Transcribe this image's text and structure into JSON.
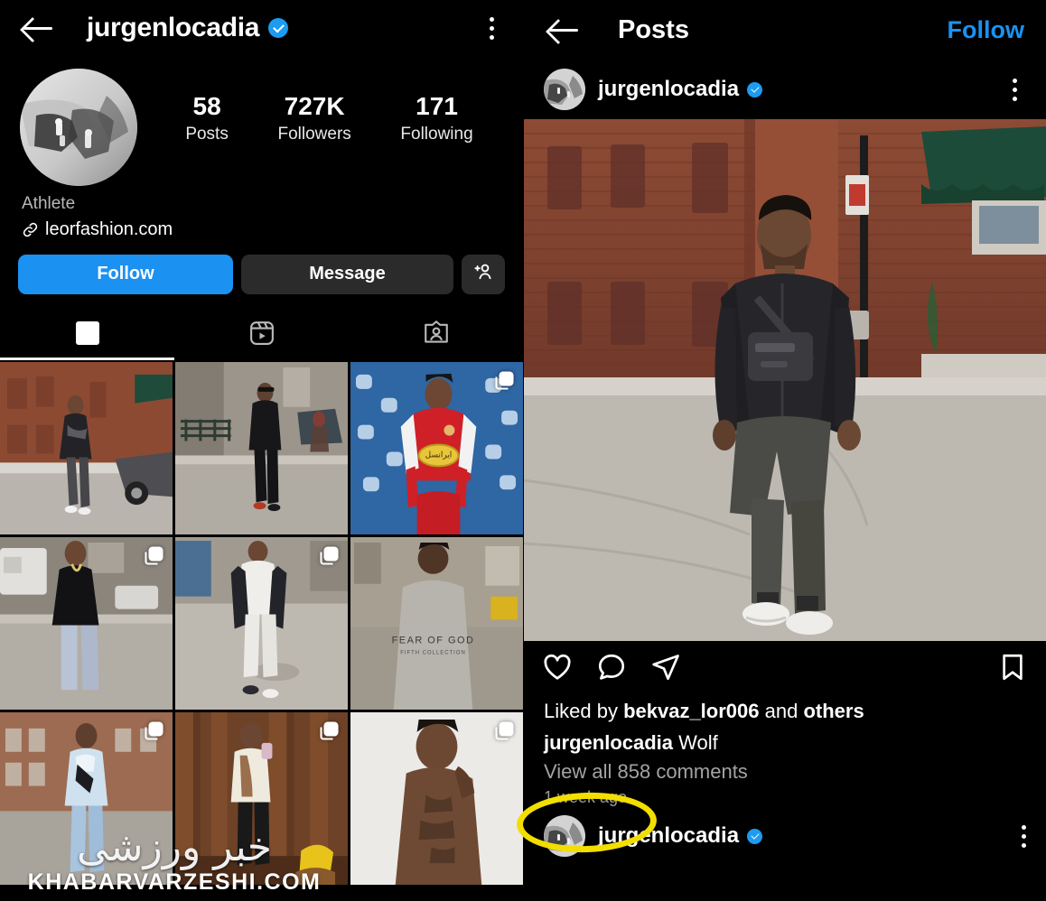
{
  "app": "instagram",
  "colors": {
    "background": "#000000",
    "accent_blue": "#1b91f2",
    "verified_blue": "#1d9bf0",
    "button_grey": "#2b2b2b",
    "muted_text": "#a3a3a3",
    "highlight_yellow": "#F2DE00"
  },
  "profile_pane": {
    "back_icon": "back-arrow-icon",
    "title": "jurgenlocadia",
    "verified": true,
    "menu_icon": "kebab-menu-icon",
    "avatar_alt": "profile-picture",
    "stats": [
      {
        "value": "58",
        "label": "Posts"
      },
      {
        "value": "727K",
        "label": "Followers"
      },
      {
        "value": "171",
        "label": "Following"
      }
    ],
    "category": "Athlete",
    "website_icon": "link-icon",
    "website": "leorfashion.com",
    "buttons": {
      "follow": "Follow",
      "message": "Message",
      "add_user_icon": "add-user-icon"
    },
    "tabs": [
      {
        "icon": "grid-icon",
        "name": "grid",
        "active": true
      },
      {
        "icon": "reels-icon",
        "name": "reels",
        "active": false
      },
      {
        "icon": "tagged-icon",
        "name": "tagged",
        "active": false
      }
    ],
    "grid_posts": [
      {
        "id": 1,
        "alt": "man-walking-street-brick-building",
        "carousel": false
      },
      {
        "id": 2,
        "alt": "man-standing-sidewalk-black-outfit",
        "carousel": false
      },
      {
        "id": 3,
        "alt": "footballer-red-persepolis-jersey",
        "carousel": true
      },
      {
        "id": 4,
        "alt": "man-black-tshirt-light-jeans",
        "carousel": true
      },
      {
        "id": 5,
        "alt": "man-black-coat-white-outfit",
        "carousel": true
      },
      {
        "id": 6,
        "alt": "man-back-fear-of-god-sweatshirt",
        "carousel": false
      },
      {
        "id": 7,
        "alt": "man-light-blue-jacket-street",
        "carousel": true
      },
      {
        "id": 8,
        "alt": "man-mirror-selfie-white-jacket",
        "carousel": true
      },
      {
        "id": 9,
        "alt": "man-shirtless-tattoo-portrait",
        "carousel": true
      }
    ],
    "watermark": {
      "farsi": "خبر ورزشی",
      "latin": "KHABARVARZESHI.COM"
    }
  },
  "post_pane": {
    "back_icon": "back-arrow-icon",
    "title": "Posts",
    "follow_label": "Follow",
    "author": {
      "username": "jurgenlocadia",
      "verified": true,
      "menu_icon": "kebab-menu-icon",
      "avatar_alt": "author-avatar"
    },
    "photo_alt": "jurgen-locadia-walking-street-black-jacket-crossbody-bag",
    "actions": {
      "like_icon": "heart-icon",
      "comment_icon": "comment-icon",
      "share_icon": "share-paperplane-icon",
      "save_icon": "bookmark-icon"
    },
    "liked_by_prefix": "Liked by ",
    "liked_by_user": "bekvaz_lor006",
    "liked_by_middle": " and ",
    "liked_by_suffix": "others",
    "caption_user": "jurgenlocadia",
    "caption_text": " Wolf",
    "view_comments": "View all 858 comments",
    "timestamp": "1 week ago",
    "next_post_username": "jurgenlocadia",
    "next_post_verified": true,
    "next_post_menu_icon": "kebab-menu-icon"
  },
  "annotation": {
    "type": "ellipse-highlight",
    "target": "1 week ago",
    "color": "#F2DE00"
  }
}
